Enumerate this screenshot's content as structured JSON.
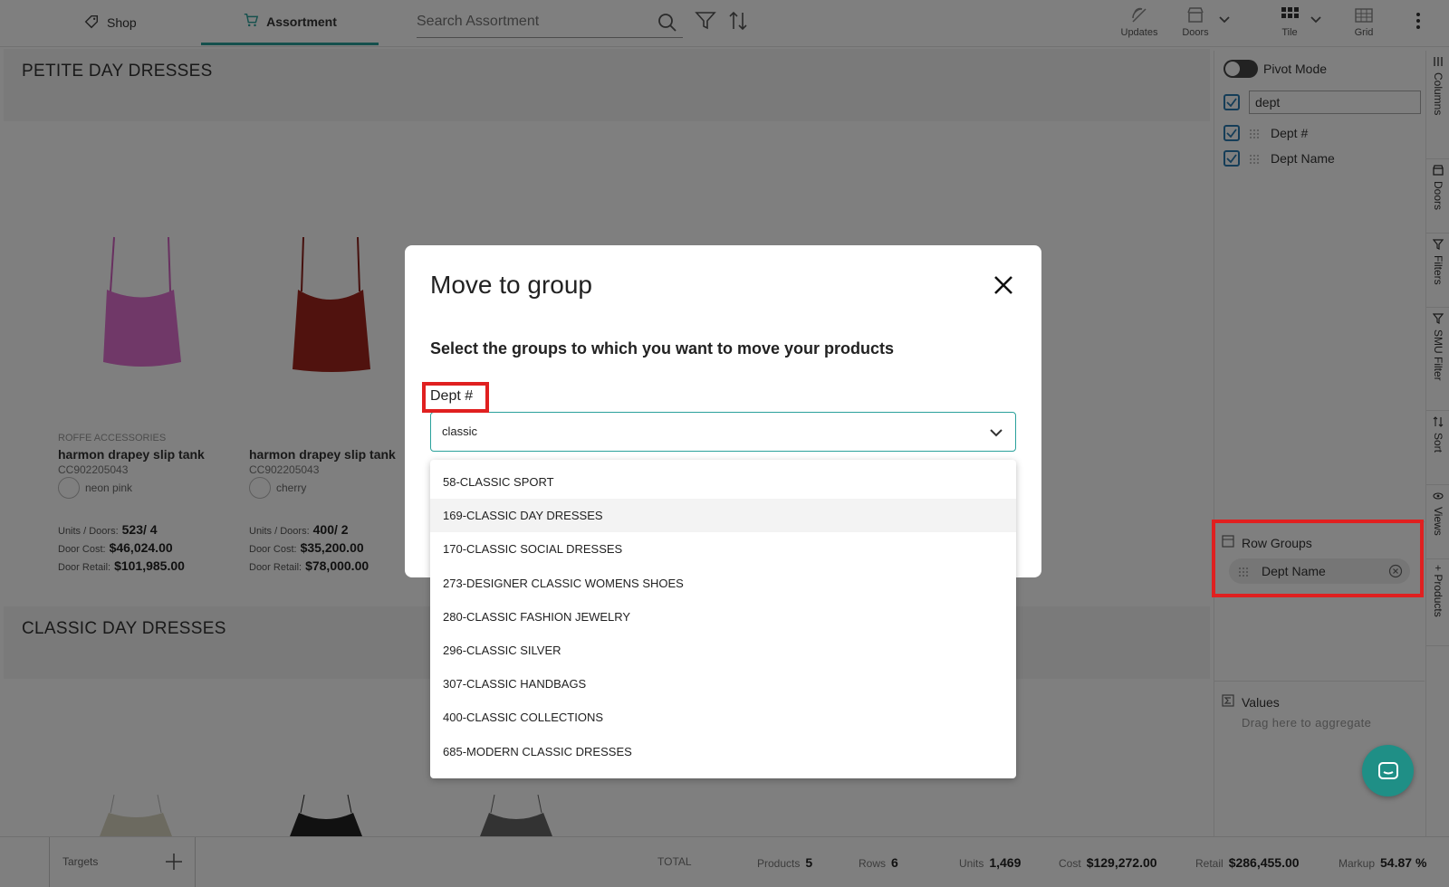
{
  "nav": {
    "shop_label": "Shop",
    "assortment_label": "Assortment",
    "search_placeholder": "Search Assortment"
  },
  "toolbar": {
    "updates": "Updates",
    "doors": "Doors",
    "tile": "Tile",
    "grid": "Grid"
  },
  "groups": [
    {
      "title": "PETITE DAY DRESSES",
      "cards": [
        {
          "brand": "ROFFE ACCESSORIES",
          "name": "harmon drapey slip tank",
          "sku": "CC902205043",
          "color": "neon pink",
          "swatch_color": "#e070d0",
          "units_label": "Units / Doors:",
          "units_value": "523/ 4",
          "cost_label": "Door Cost:",
          "cost_value": "$46,024.00",
          "retail_label": "Door Retail:",
          "retail_value": "$101,985.00"
        },
        {
          "brand": "",
          "name": "harmon drapey slip tank",
          "sku": "CC902205043",
          "color": "cherry",
          "swatch_color": "#a0251c",
          "units_label": "Units / Doors:",
          "units_value": "400/ 2",
          "cost_label": "Door Cost:",
          "cost_value": "$35,200.00",
          "retail_label": "Door Retail:",
          "retail_value": "$78,000.00"
        }
      ]
    },
    {
      "title": "CLASSIC DAY DRESSES",
      "cards": []
    }
  ],
  "right_panel": {
    "pivot_mode": "Pivot Mode",
    "column_filter_value": "dept",
    "columns": [
      "Dept #",
      "Dept Name"
    ],
    "row_groups_title": "Row Groups",
    "row_group_item": "Dept Name",
    "values_title": "Values",
    "values_hint": "Drag here to aggregate"
  },
  "side_tabs": [
    "Columns",
    "Doors",
    "Filters",
    "SMU Filter",
    "Sort",
    "Views",
    "+ Products"
  ],
  "bottom_bar": {
    "targets_label": "Targets",
    "total_label": "TOTAL",
    "products_label": "Products",
    "products_value": "5",
    "rows_label": "Rows",
    "rows_value": "6",
    "units_label": "Units",
    "units_value": "1,469",
    "cost_label": "Cost",
    "cost_value": "$129,272.00",
    "retail_label": "Retail",
    "retail_value": "$286,455.00",
    "markup_label": "Markup",
    "markup_value": "54.87 %"
  },
  "modal": {
    "title": "Move to group",
    "subtitle": "Select the groups to which you want to move your products",
    "field_label": "Dept #",
    "input_value": "classic",
    "options": [
      "58-CLASSIC SPORT",
      "169-CLASSIC DAY DRESSES",
      "170-CLASSIC SOCIAL DRESSES",
      "273-DESIGNER CLASSIC WOMENS SHOES",
      "280-CLASSIC FASHION JEWELRY",
      "296-CLASSIC SILVER",
      "307-CLASSIC HANDBAGS",
      "400-CLASSIC COLLECTIONS",
      "685-MODERN CLASSIC DRESSES"
    ]
  },
  "colors": {
    "accent": "#2aa19b",
    "highlight": "#e02020",
    "chat": "#1f8f86"
  }
}
